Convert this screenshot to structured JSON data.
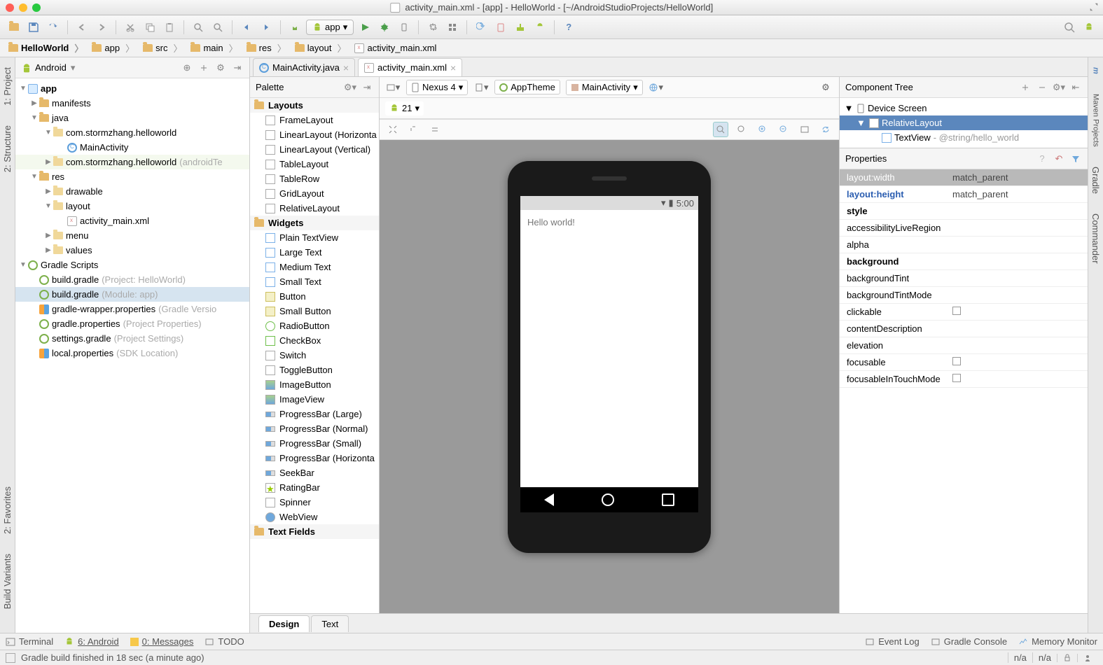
{
  "titlebar": {
    "title": "activity_main.xml - [app] - HelloWorld - [~/AndroidStudioProjects/HelloWorld]"
  },
  "toolbar": {
    "run_config": "app"
  },
  "breadcrumbs": [
    "HelloWorld",
    "app",
    "src",
    "main",
    "res",
    "layout",
    "activity_main.xml"
  ],
  "project": {
    "selector": "Android",
    "tree": {
      "app": "app",
      "manifests": "manifests",
      "java": "java",
      "pkg1": "com.stormzhang.helloworld",
      "pkg1_hint": "",
      "main_activity": "MainActivity",
      "pkg2": "com.stormzhang.helloworld",
      "pkg2_hint": "(androidTe",
      "res": "res",
      "drawable": "drawable",
      "layout": "layout",
      "layout_file": "activity_main.xml",
      "menu": "menu",
      "values": "values",
      "gradle_scripts": "Gradle Scripts",
      "bg_proj": "build.gradle",
      "bg_proj_hint": "(Project: HelloWorld)",
      "bg_mod": "build.gradle",
      "bg_mod_hint": "(Module: app)",
      "gwp": "gradle-wrapper.properties",
      "gwp_hint": "(Gradle Versio",
      "gp": "gradle.properties",
      "gp_hint": "(Project Properties)",
      "sg": "settings.gradle",
      "sg_hint": "(Project Settings)",
      "lp": "local.properties",
      "lp_hint": "(SDK Location)"
    }
  },
  "editor": {
    "tabs": [
      {
        "label": "MainActivity.java",
        "icon": "class"
      },
      {
        "label": "activity_main.xml",
        "icon": "xml",
        "active": true
      }
    ],
    "design_tab": "Design",
    "text_tab": "Text"
  },
  "palette": {
    "title": "Palette",
    "groups": {
      "layouts": "Layouts",
      "widgets": "Widgets",
      "textfields": "Text Fields"
    },
    "layouts": [
      "FrameLayout",
      "LinearLayout (Horizonta",
      "LinearLayout (Vertical)",
      "TableLayout",
      "TableRow",
      "GridLayout",
      "RelativeLayout"
    ],
    "widgets": [
      "Plain TextView",
      "Large Text",
      "Medium Text",
      "Small Text",
      "Button",
      "Small Button",
      "RadioButton",
      "CheckBox",
      "Switch",
      "ToggleButton",
      "ImageButton",
      "ImageView",
      "ProgressBar (Large)",
      "ProgressBar (Normal)",
      "ProgressBar (Small)",
      "ProgressBar (Horizonta",
      "SeekBar",
      "RatingBar",
      "Spinner",
      "WebView"
    ]
  },
  "designer": {
    "device": "Nexus 4",
    "theme": "AppTheme",
    "activity": "MainActivity",
    "api": "21",
    "status_time": "5:00",
    "hello": "Hello world!"
  },
  "comp_tree": {
    "title": "Component Tree",
    "root": "Device Screen",
    "rel": "RelativeLayout",
    "tv": "TextView",
    "tv_hint": "- @string/hello_world"
  },
  "properties": {
    "title": "Properties",
    "rows": [
      {
        "name": "layout:width",
        "value": "match_parent",
        "head": true
      },
      {
        "name": "layout:height",
        "value": "match_parent",
        "highlight": true
      },
      {
        "name": "style",
        "value": "",
        "bold": true
      },
      {
        "name": "accessibilityLiveRegion",
        "value": ""
      },
      {
        "name": "alpha",
        "value": ""
      },
      {
        "name": "background",
        "value": "",
        "bold": true
      },
      {
        "name": "backgroundTint",
        "value": ""
      },
      {
        "name": "backgroundTintMode",
        "value": ""
      },
      {
        "name": "clickable",
        "value": "",
        "check": true
      },
      {
        "name": "contentDescription",
        "value": ""
      },
      {
        "name": "elevation",
        "value": ""
      },
      {
        "name": "focusable",
        "value": "",
        "check": true
      },
      {
        "name": "focusableInTouchMode",
        "value": "",
        "check": true
      }
    ]
  },
  "bottom": {
    "terminal": "Terminal",
    "android": "6: Android",
    "messages": "0: Messages",
    "todo": "TODO",
    "eventlog": "Event Log",
    "gradle_console": "Gradle Console",
    "memory": "Memory Monitor"
  },
  "status": {
    "msg": "Gradle build finished in 18 sec (a minute ago)",
    "seg1": "n/a",
    "seg2": "n/a"
  },
  "gutters": {
    "left": [
      "1: Project",
      "2: Structure",
      "2: Favorites",
      "Build Variants"
    ],
    "right": [
      "Maven Projects",
      "Gradle",
      "Commander"
    ]
  }
}
